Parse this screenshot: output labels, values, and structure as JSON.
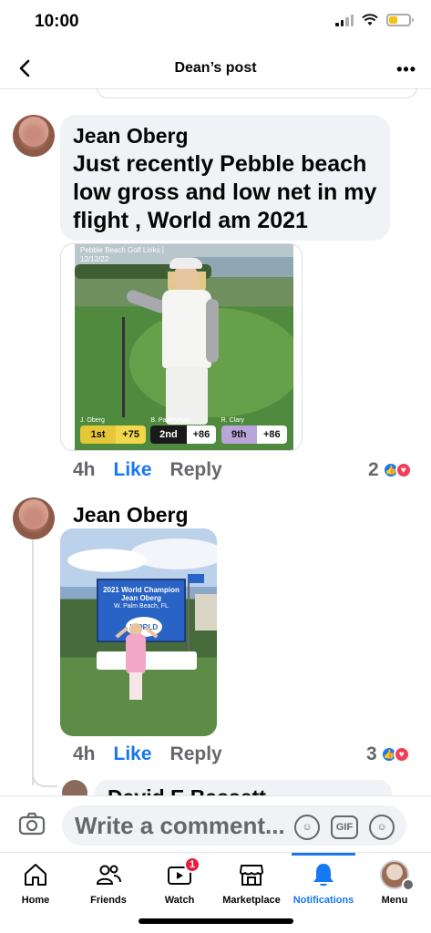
{
  "status": {
    "time": "10:00"
  },
  "nav": {
    "title": "Dean’s post"
  },
  "comments": [
    {
      "author": "Jean Oberg",
      "text": "Just recently Pebble beach low gross and low net in my flight , World am 2021",
      "photo": {
        "caption_line1": "Pebble Beach Golf Links |",
        "caption_line2": "12/12/22",
        "scores": [
          {
            "name": "J. Oberg",
            "position": "1st",
            "value": "+75"
          },
          {
            "name": "B. Pallreyman",
            "position": "2nd",
            "value": "+86"
          },
          {
            "name": "R. Clary",
            "position": "9th",
            "value": "+86"
          }
        ]
      },
      "time": "4h",
      "like": "Like",
      "reply": "Reply",
      "reaction_count": "2"
    },
    {
      "author": "Jean Oberg",
      "photo": {
        "banner_title": "2021 World Champion",
        "banner_name": "Jean Oberg",
        "banner_place": "W. Palm Beach, FL",
        "banner_logo": "WORLD"
      },
      "time": "4h",
      "like": "Like",
      "reply": "Reply",
      "reaction_count": "3"
    }
  ],
  "next_comment": {
    "author": "David E Bassett"
  },
  "composer": {
    "placeholder": "Write a comment...",
    "gif_label": "GIF"
  },
  "tabs": [
    {
      "label": "Home",
      "icon": "home-icon"
    },
    {
      "label": "Friends",
      "icon": "friends-icon"
    },
    {
      "label": "Watch",
      "icon": "watch-icon",
      "badge": "1"
    },
    {
      "label": "Marketplace",
      "icon": "marketplace-icon"
    },
    {
      "label": "Notifications",
      "icon": "bell-icon",
      "active": true
    },
    {
      "label": "Menu",
      "icon": "menu-avatar-icon"
    }
  ],
  "colors": {
    "accent": "#1877f2",
    "bubble": "#f0f2f5",
    "muted": "#65676b",
    "badge": "#e41e3f"
  }
}
